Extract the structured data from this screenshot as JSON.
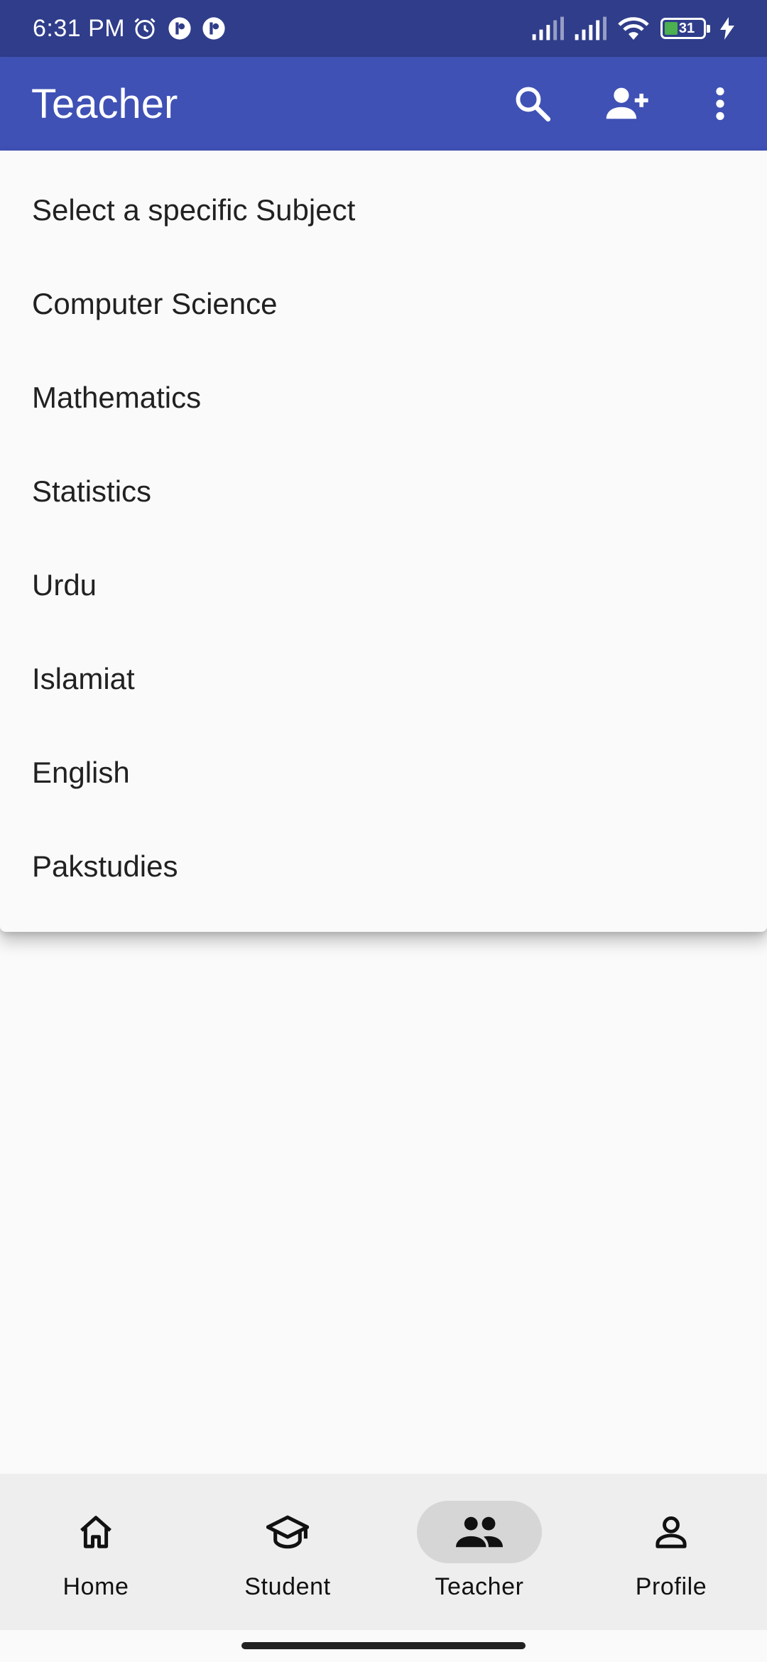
{
  "status_bar": {
    "time": "6:31 PM",
    "battery_level": "31",
    "icons": [
      "alarm-icon",
      "app-notification-icon",
      "app-notification-icon",
      "signal-icon",
      "signal-icon",
      "wifi-icon",
      "battery-icon",
      "charging-icon"
    ]
  },
  "app_bar": {
    "title": "Teacher",
    "actions": [
      "search-icon",
      "add-person-icon",
      "more-vert-icon"
    ],
    "color": "#3f51b5"
  },
  "menu": {
    "items": [
      "Select a specific Subject",
      "Computer Science",
      "Mathematics",
      "Statistics",
      "Urdu",
      "Islamiat",
      "English",
      "Pakstudies"
    ]
  },
  "bottom_nav": {
    "items": [
      {
        "label": "Home",
        "icon": "home-icon",
        "active": false
      },
      {
        "label": "Student",
        "icon": "school-icon",
        "active": false
      },
      {
        "label": "Teacher",
        "icon": "people-icon",
        "active": true
      },
      {
        "label": "Profile",
        "icon": "person-icon",
        "active": false
      }
    ]
  }
}
